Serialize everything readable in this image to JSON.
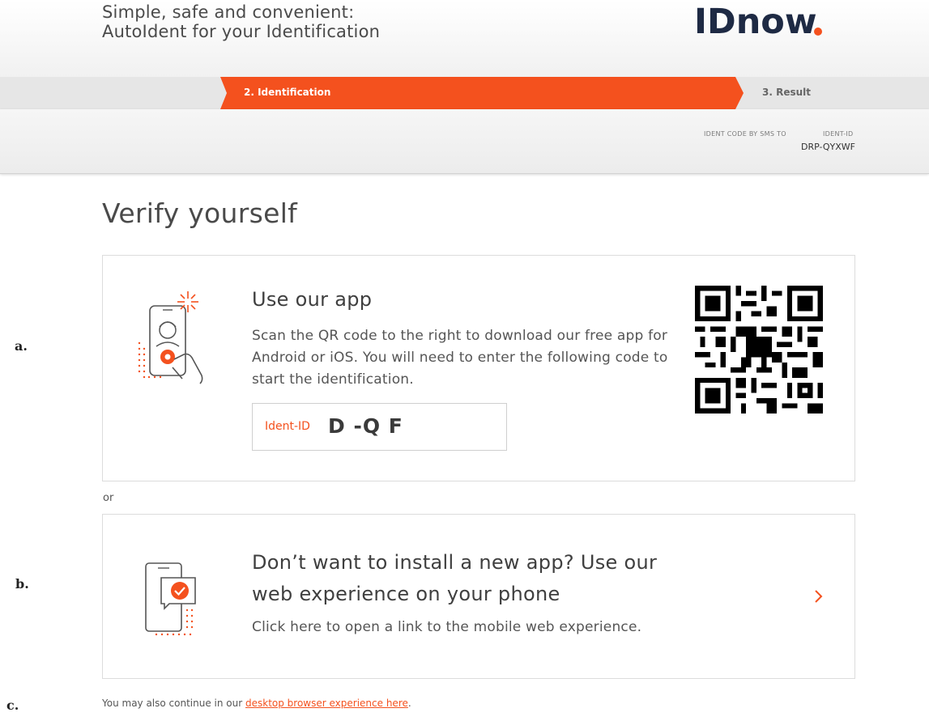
{
  "header": {
    "title_line1": "Simple, safe and convenient:",
    "title_line2": "AutoIdent for your Identification",
    "logo_text": "IDnow"
  },
  "steps": {
    "active_label": "2. Identification",
    "next_label": "3. Result"
  },
  "info": {
    "sms_label": "IDENT CODE BY SMS TO",
    "ident_label": "IDENT-ID",
    "ident_value": "DRP-QYXWF"
  },
  "page": {
    "heading": "Verify yourself"
  },
  "app_card": {
    "marker": "a.",
    "title": "Use our app",
    "text": "Scan the QR code to the right to download our free app for Android or iOS. You will need to enter the following code to start the identification.",
    "ident_label": "Ident-ID",
    "ident_code": "D   -Q     F"
  },
  "separator": {
    "or": "or"
  },
  "web_card": {
    "marker": "b.",
    "title_line1": "Don’t want to install a new app? Use our",
    "title_line2": "web experience on your phone",
    "text": "Click here to open a link to the mobile web experience."
  },
  "footer": {
    "marker": "c.",
    "text_before": "You may also continue in our ",
    "link_text": "desktop browser experience here",
    "text_after": "."
  },
  "colors": {
    "accent": "#f4511e",
    "text_dark": "#3a3a3a",
    "border": "#dcdcdc"
  },
  "icons": {
    "logo": "idnow-logo",
    "app_illustration": "phone-selfie-icon",
    "web_illustration": "phone-checkmark-icon",
    "qr": "qr-code-icon",
    "chevron": "chevron-right-icon"
  }
}
